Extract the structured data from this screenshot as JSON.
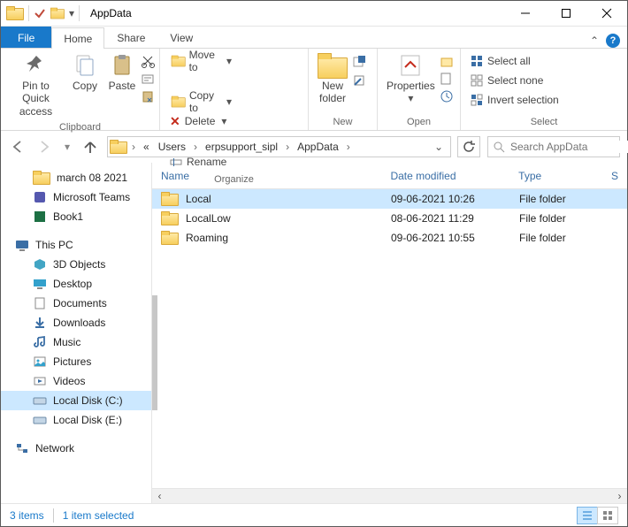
{
  "window": {
    "title": "AppData"
  },
  "tabs": {
    "file": "File",
    "home": "Home",
    "share": "Share",
    "view": "View"
  },
  "ribbon": {
    "clipboard": {
      "caption": "Clipboard",
      "pin": "Pin to Quick\naccess",
      "copy": "Copy",
      "paste": "Paste"
    },
    "organize": {
      "caption": "Organize",
      "moveto": "Move to",
      "copyto": "Copy to",
      "delete": "Delete",
      "rename": "Rename"
    },
    "new": {
      "caption": "New",
      "newfolder": "New\nfolder"
    },
    "open": {
      "caption": "Open",
      "properties": "Properties"
    },
    "select": {
      "caption": "Select",
      "all": "Select all",
      "none": "Select none",
      "invert": "Invert selection"
    }
  },
  "breadcrumb": {
    "items": [
      "«",
      "Users",
      "erpsupport_sipl",
      "AppData"
    ]
  },
  "search": {
    "placeholder": "Search AppData"
  },
  "sidebar_quick": {
    "i0": "march 08 2021",
    "i1": "Microsoft Teams",
    "i2": "Book1"
  },
  "sidebar_pc": {
    "root": "This PC",
    "i0": "3D Objects",
    "i1": "Desktop",
    "i2": "Documents",
    "i3": "Downloads",
    "i4": "Music",
    "i5": "Pictures",
    "i6": "Videos",
    "i7": "Local Disk (C:)",
    "i8": "Local Disk (E:)"
  },
  "sidebar_net": {
    "root": "Network"
  },
  "columns": {
    "name": "Name",
    "date": "Date modified",
    "type": "Type",
    "size": "S"
  },
  "rows": {
    "r0": {
      "name": "Local",
      "date": "09-06-2021 10:26",
      "type": "File folder"
    },
    "r1": {
      "name": "LocalLow",
      "date": "08-06-2021 11:29",
      "type": "File folder"
    },
    "r2": {
      "name": "Roaming",
      "date": "09-06-2021 10:55",
      "type": "File folder"
    }
  },
  "status": {
    "count": "3 items",
    "selected": "1 item selected"
  },
  "colors": {
    "accent": "#1979ca",
    "selection": "#cce8ff"
  }
}
